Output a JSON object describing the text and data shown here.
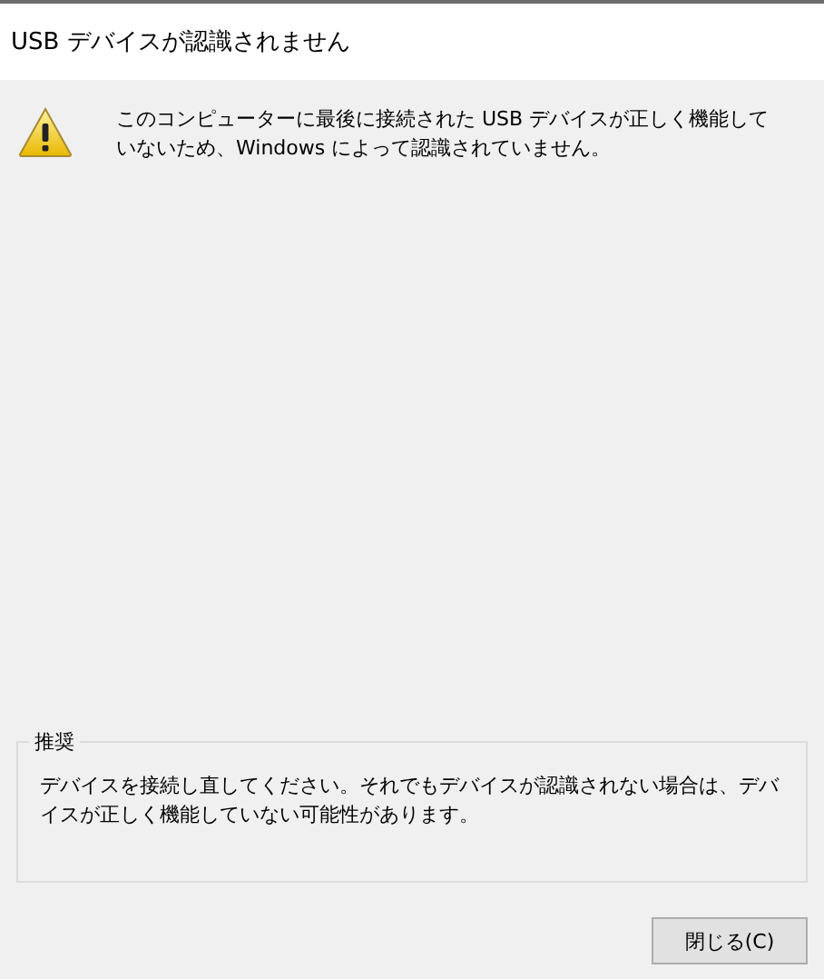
{
  "window": {
    "title": "USB デバイスが認識されません"
  },
  "message": "このコンピューターに最後に接続された USB デバイスが正しく機能していないため、Windows によって認識されていません。",
  "recommendation": {
    "heading": "推奨",
    "text": "デバイスを接続し直してください。それでもデバイスが認識されない場合は、デバイスが正しく機能していない可能性があります。"
  },
  "buttons": [
    "閉じる(C)"
  ]
}
